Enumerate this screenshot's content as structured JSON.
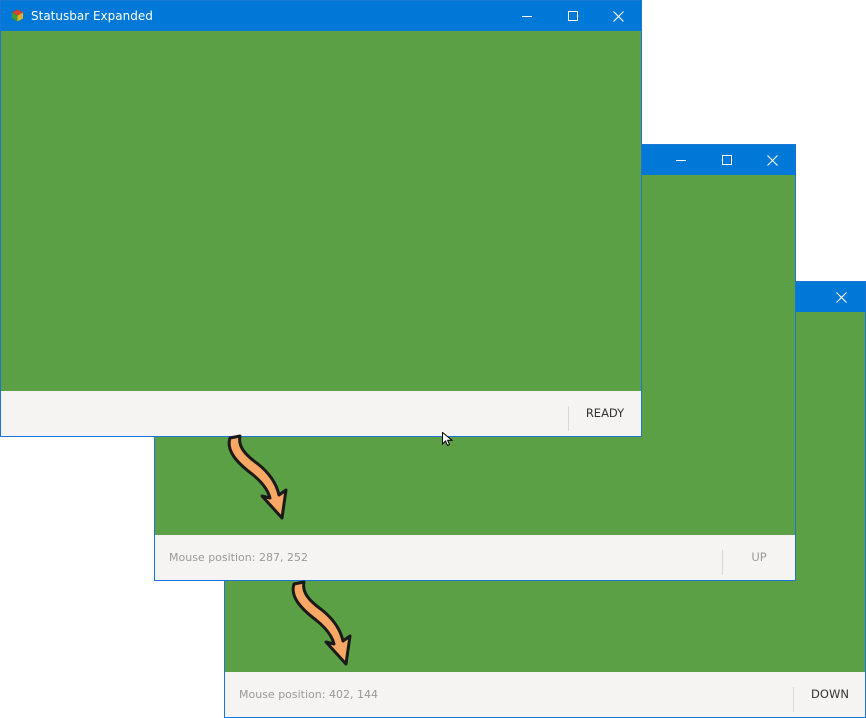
{
  "windows": [
    {
      "title": "Statusbar Expanded",
      "status_text": "",
      "state": "READY",
      "state_color": "#333333"
    },
    {
      "title": "",
      "status_text": "Mouse position: 287, 252",
      "state": "UP",
      "state_color": "#999999"
    },
    {
      "title": "",
      "status_text": "Mouse position: 402, 144",
      "state": "DOWN",
      "state_color": "#333333"
    }
  ],
  "window_controls": [
    "minimize-icon",
    "maximize-icon",
    "close-icon"
  ],
  "colors": {
    "titlebar": "#0078d7",
    "client": "#5ca045",
    "statusbar": "#f5f4f2",
    "arrow": "#f9a765"
  }
}
